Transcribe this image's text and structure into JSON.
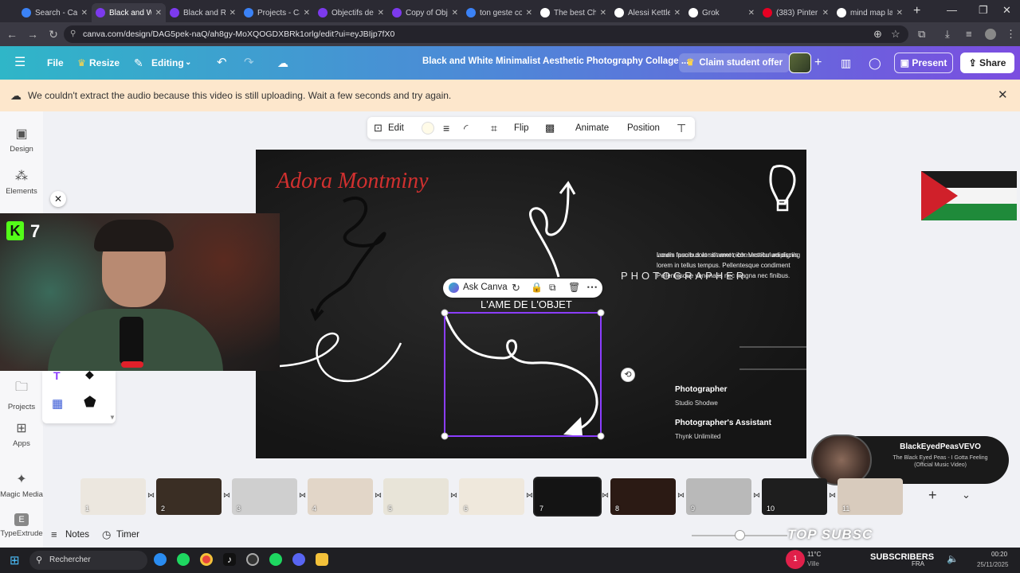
{
  "browser": {
    "tabs": [
      {
        "label": "Search - Ca",
        "color": "#3b82f6",
        "active": false
      },
      {
        "label": "Black and W",
        "color": "#7c3aed",
        "active": true
      },
      {
        "label": "Black and R",
        "color": "#7c3aed",
        "active": false
      },
      {
        "label": "Projects - Ca",
        "color": "#3b82f6",
        "active": false
      },
      {
        "label": "Objectifs de",
        "color": "#7c3aed",
        "active": false
      },
      {
        "label": "Copy of Obj",
        "color": "#7c3aed",
        "active": false
      },
      {
        "label": "ton geste co",
        "color": "#3b82f6",
        "active": false
      },
      {
        "label": "The best Ch",
        "color": "#ffffff",
        "active": false
      },
      {
        "label": "Alessi Kettle",
        "color": "#ffffff",
        "active": false
      },
      {
        "label": "Grok",
        "color": "#ffffff",
        "active": false
      },
      {
        "label": "(383) Pinter",
        "color": "#e60023",
        "active": false
      },
      {
        "label": "mind map la",
        "color": "#ffffff",
        "active": false
      }
    ],
    "url": "canva.com/design/DAG5pek-naQ/ah8gy-MoXQOGDXBRk1orlg/edit?ui=eyJBIjp7fX0"
  },
  "header": {
    "file_label": "File",
    "resize_label": "Resize",
    "editing_label": "Editing",
    "doc_title": "Black and White Minimalist Aesthetic Photography Collage ...",
    "claim_label": "Claim student offer",
    "present_label": "Present",
    "share_label": "Share"
  },
  "banner": {
    "message": "We couldn't extract the audio because this video is still uploading. Wait a few seconds and try again."
  },
  "sidebar": {
    "items": [
      {
        "label": "Design"
      },
      {
        "label": "Elements"
      },
      {
        "label": "Projects"
      },
      {
        "label": "Apps"
      },
      {
        "label": "Magic Media"
      },
      {
        "label": "TypeExtrude"
      }
    ]
  },
  "toolbar": {
    "edit_label": "Edit",
    "flip_label": "Flip",
    "animate_label": "Animate",
    "position_label": "Position"
  },
  "canvas": {
    "name": "Adora Montminy",
    "photographer_heading": "PHOTOGRAPHER",
    "lorem": "Lorem ipsum dolor sit amet, consectetur adipiscing iaculis faucibus at sit amet nibh. Vestibulum dignis lorem in tellus tempus. Pellentesque condiment Pellentesque venenatis nec magna nec finibus.",
    "lorem_lines": [
      "Lorem ipsum dolor sit amet, consectetur adipiscing",
      "iaculis faucibus at sit amet nibh. Vestibulum dignis",
      "lorem in tellus tempus. Pellentesque  condiment",
      "Pellentesque venenatis nec magna nec finibus."
    ],
    "selected_text": "L'AME DE L'OBJET",
    "role1": "Photographer",
    "role1_sub": "Studio Shodwe",
    "role2": "Photographer's Assistant",
    "role2_sub": "Thynk Unlimited"
  },
  "ask_canva": {
    "label": "Ask Canva"
  },
  "webcam": {
    "badge": "7"
  },
  "pages": {
    "thumbnails": [
      {
        "num": "1",
        "bg": "#ece7df"
      },
      {
        "num": "2",
        "bg": "#3a2e24"
      },
      {
        "num": "3",
        "bg": "#cfcfcf"
      },
      {
        "num": "4",
        "bg": "#e2d6c8"
      },
      {
        "num": "5",
        "bg": "#e8e4d8"
      },
      {
        "num": "6",
        "bg": "#efe8dc"
      },
      {
        "num": "7",
        "bg": "#141414"
      },
      {
        "num": "8",
        "bg": "#2b1a14"
      },
      {
        "num": "9",
        "bg": "#b9b9b9"
      },
      {
        "num": "10",
        "bg": "#1e1e1e"
      },
      {
        "num": "11",
        "bg": "#d8cbbd"
      }
    ]
  },
  "footer": {
    "notes_label": "Notes",
    "timer_label": "Timer"
  },
  "music": {
    "artist": "BlackEyedPeasVEVO",
    "title_line1": "The Black Eyed Peas - I Gotta Feeling",
    "title_line2": "(Official Music Video)"
  },
  "overlay": {
    "subscribers_label": "SUBSCRIBERS",
    "subscribers_count": "1",
    "top_sub_label": "TOP SUBSC"
  },
  "taskbar": {
    "search_placeholder": "Rechercher",
    "temperature": "11°C",
    "weather": "Ville",
    "time": "00:20",
    "date": "25/11/2025",
    "lang": "FRA"
  },
  "colors": {
    "brand_gradient_start": "#2fb6c8",
    "brand_gradient_end": "#7b4de0",
    "selection": "#8b3dff",
    "name_red": "#d0302f"
  }
}
